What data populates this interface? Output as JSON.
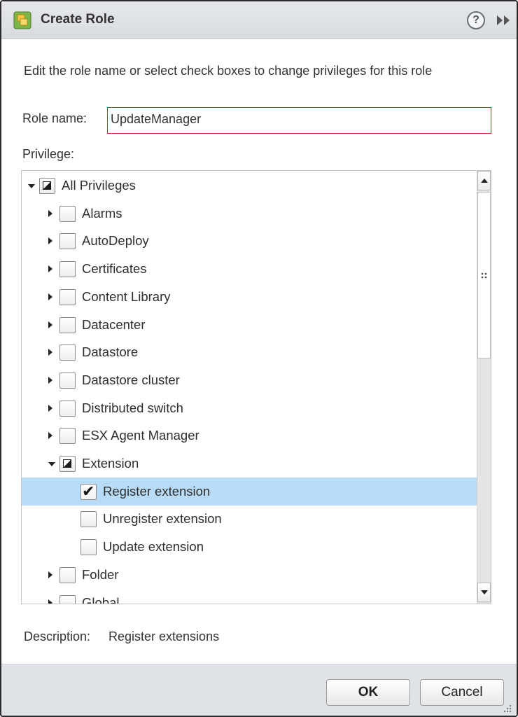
{
  "dialog": {
    "title": "Create Role",
    "title_icon": "role-icon",
    "help_label": "?",
    "help_icon": "help-icon",
    "collapse_icon": "double-chevron-right-icon"
  },
  "form": {
    "intro": "Edit the role name or select check boxes to change privileges for this role",
    "role_name_label": "Role name:",
    "role_name_value": "UpdateManager",
    "privilege_label": "Privilege:"
  },
  "tree": {
    "items": [
      {
        "label": "All Privileges",
        "level": 0,
        "expand": "down",
        "check": "partial",
        "selected": false
      },
      {
        "label": "Alarms",
        "level": 1,
        "expand": "right",
        "check": "none",
        "selected": false
      },
      {
        "label": "AutoDeploy",
        "level": 1,
        "expand": "right",
        "check": "none",
        "selected": false
      },
      {
        "label": "Certificates",
        "level": 1,
        "expand": "right",
        "check": "none",
        "selected": false
      },
      {
        "label": "Content Library",
        "level": 1,
        "expand": "right",
        "check": "none",
        "selected": false
      },
      {
        "label": "Datacenter",
        "level": 1,
        "expand": "right",
        "check": "none",
        "selected": false
      },
      {
        "label": "Datastore",
        "level": 1,
        "expand": "right",
        "check": "none",
        "selected": false
      },
      {
        "label": "Datastore cluster",
        "level": 1,
        "expand": "right",
        "check": "none",
        "selected": false
      },
      {
        "label": "Distributed switch",
        "level": 1,
        "expand": "right",
        "check": "none",
        "selected": false
      },
      {
        "label": "ESX Agent Manager",
        "level": 1,
        "expand": "right",
        "check": "none",
        "selected": false
      },
      {
        "label": "Extension",
        "level": 1,
        "expand": "down",
        "check": "partial",
        "selected": false
      },
      {
        "label": "Register extension",
        "level": 2,
        "expand": "none",
        "check": "checked",
        "selected": true
      },
      {
        "label": "Unregister extension",
        "level": 2,
        "expand": "none",
        "check": "none",
        "selected": false
      },
      {
        "label": "Update extension",
        "level": 2,
        "expand": "none",
        "check": "none",
        "selected": false
      },
      {
        "label": "Folder",
        "level": 1,
        "expand": "right",
        "check": "none",
        "selected": false
      },
      {
        "label": "Global",
        "level": 1,
        "expand": "right",
        "check": "none",
        "selected": false
      }
    ],
    "checkmark_glyph": "✔"
  },
  "description": {
    "label": "Description:",
    "value": "Register extensions"
  },
  "buttons": {
    "ok": "OK",
    "cancel": "Cancel"
  }
}
